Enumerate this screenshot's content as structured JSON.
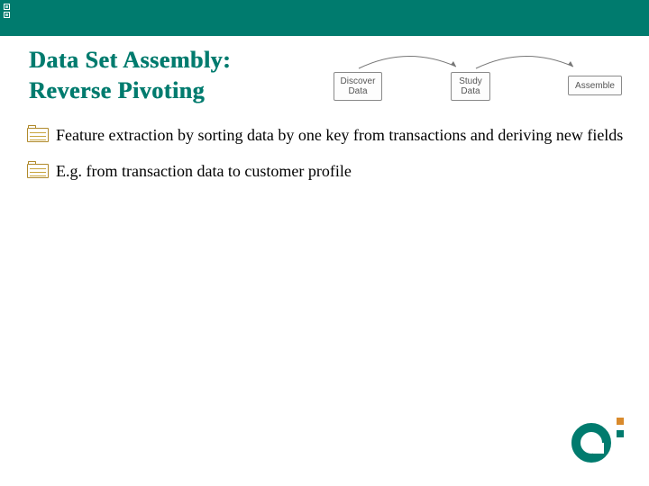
{
  "title": {
    "line1": "Data Set Assembly:",
    "line2": "Reverse Pivoting"
  },
  "flow": {
    "step1": "Discover\nData",
    "step2": "Study\nData",
    "step3": "Assemble"
  },
  "bullets": [
    "Feature extraction by sorting data by one key from transactions and deriving new fields",
    "E.g. from transaction data to customer profile"
  ]
}
